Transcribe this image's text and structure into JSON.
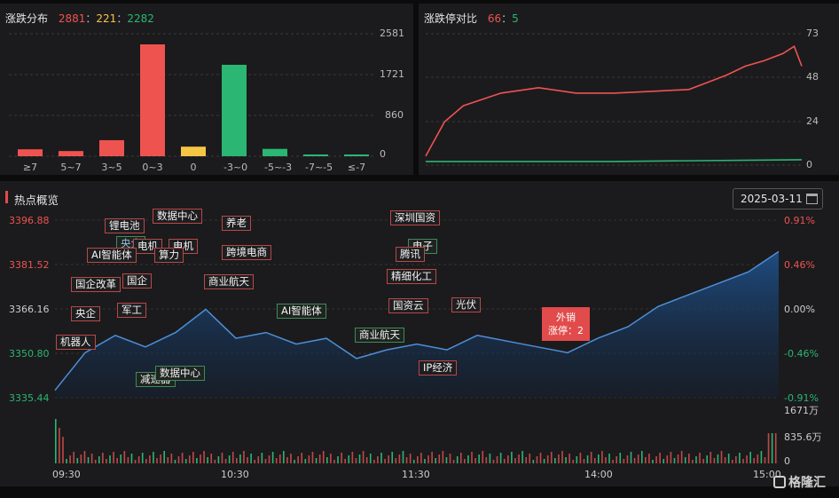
{
  "distribution": {
    "title": "涨跌分布",
    "up_count": "2881",
    "flat_count": "221",
    "down_count": "2282",
    "sep1": "：",
    "sep2": "：",
    "y_ticks": [
      "2581",
      "1721",
      "860",
      "0"
    ],
    "categories": [
      "≥7",
      "5~7",
      "3~5",
      "0~3",
      "0",
      "-3~0",
      "-5~-3",
      "-7~-5",
      "≤-7"
    ]
  },
  "limit_ratio": {
    "title": "涨跌停对比",
    "limit_up": "66",
    "sep": "：",
    "limit_down": "5",
    "y_ticks": [
      "73",
      "48",
      "24",
      "0"
    ]
  },
  "hot": {
    "title": "热点概览",
    "date": "2025-03-11",
    "calendar_icon": "calendar-icon",
    "price_ticks": [
      "3396.88",
      "3381.52",
      "3366.16",
      "3350.80",
      "3335.44"
    ],
    "pct_ticks": [
      "0.91%",
      "0.46%",
      "0.00%",
      "-0.46%",
      "-0.91%"
    ],
    "volume_ticks": [
      "1671万",
      "835.6万",
      "0"
    ],
    "time_ticks": [
      "09:30",
      "10:30",
      "11:30",
      "14:00",
      "15:00"
    ],
    "labels": {
      "a1": "数据中心",
      "a2": "锂电池",
      "a3": "养老",
      "a4": "深圳国资",
      "a5": "电机",
      "a6": "电机",
      "a7": "电子",
      "a8": "AI智能体",
      "a9": "算力",
      "a10": "跨境电商",
      "a11": "腾讯",
      "a12": "国企改革",
      "a13": "国企",
      "a14": "商业航天",
      "a15": "精细化工",
      "a16": "央企",
      "a17": "军工",
      "a18": "AI智能体",
      "a19": "国资云",
      "a20": "光伏",
      "a21": "机器人",
      "a22": "商业航天",
      "a23": "IP经济",
      "a24": "数据中心",
      "a25": "减速器",
      "a26": "央企"
    },
    "callout": {
      "title": "外销",
      "text": "涨停：2"
    }
  },
  "watermark": "格隆汇",
  "colors": {
    "up": "#ef5350",
    "flat": "#f6c544",
    "down": "#2bb673",
    "line": "#4d8fd8"
  },
  "chart_data": [
    {
      "type": "bar",
      "title": "涨跌分布",
      "categories": [
        "≥7",
        "5~7",
        "3~5",
        "0~3",
        "0",
        "-3~0",
        "-5~-3",
        "-7~-5",
        "≤-7"
      ],
      "values": [
        160,
        120,
        370,
        2581,
        221,
        2110,
        170,
        40,
        15
      ],
      "ylim": [
        0,
        2581
      ]
    },
    {
      "type": "line",
      "title": "涨跌停对比",
      "series": [
        {
          "name": "涨停",
          "x": [
            0,
            0.05,
            0.1,
            0.2,
            0.3,
            0.4,
            0.5,
            0.6,
            0.7,
            0.75,
            0.8,
            0.85,
            0.9,
            0.95,
            0.98,
            1
          ],
          "values": [
            5,
            24,
            33,
            40,
            43,
            40,
            40,
            41,
            42,
            46,
            50,
            55,
            58,
            62,
            66,
            55
          ]
        },
        {
          "name": "跌停",
          "x": [
            0,
            0.5,
            1
          ],
          "values": [
            2,
            2,
            3
          ]
        }
      ],
      "ylim": [
        0,
        73
      ]
    },
    {
      "type": "area",
      "title": "热点概览",
      "x": [
        "09:30",
        "09:40",
        "09:50",
        "10:00",
        "10:10",
        "10:20",
        "10:30",
        "10:40",
        "10:50",
        "11:00",
        "11:10",
        "11:20",
        "11:30",
        "13:10",
        "13:20",
        "13:30",
        "13:40",
        "13:50",
        "14:00",
        "14:10",
        "14:20",
        "14:30",
        "14:40",
        "14:50",
        "15:00"
      ],
      "values": [
        3338,
        3351,
        3357,
        3353,
        3358,
        3366,
        3356,
        3358,
        3354,
        3356,
        3349,
        3352,
        3354,
        3352,
        3357,
        3355,
        3353,
        3351,
        3356,
        3360,
        3367,
        3371,
        3375,
        3379,
        3386
      ],
      "ylim": [
        3335.44,
        3396.88
      ]
    }
  ]
}
